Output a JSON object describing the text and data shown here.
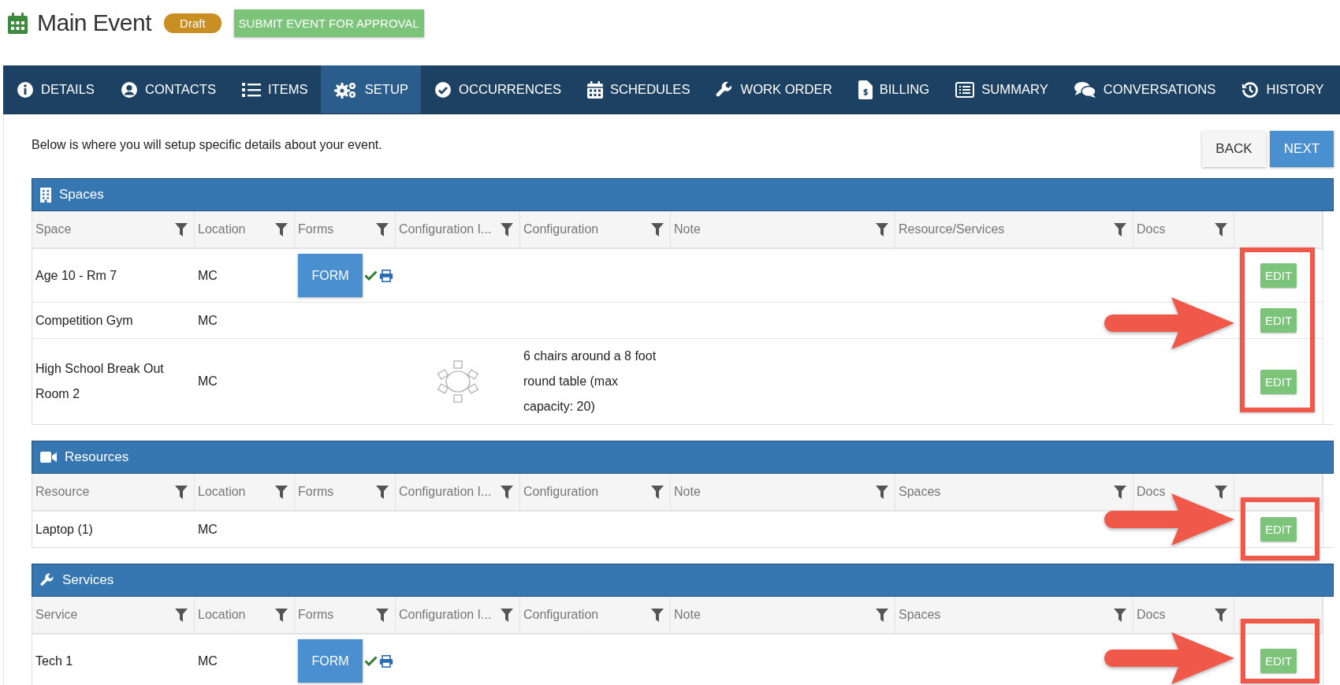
{
  "header": {
    "title": "Main Event",
    "status_badge": "Draft",
    "submit_button": "SUBMIT EVENT FOR APPROVAL"
  },
  "tabs": [
    {
      "label": "DETAILS",
      "selected": false
    },
    {
      "label": "CONTACTS",
      "selected": false
    },
    {
      "label": "ITEMS",
      "selected": false
    },
    {
      "label": "SETUP",
      "selected": true
    },
    {
      "label": "OCCURRENCES",
      "selected": false
    },
    {
      "label": "SCHEDULES",
      "selected": false
    },
    {
      "label": "WORK ORDER",
      "selected": false
    },
    {
      "label": "BILLING",
      "selected": false
    },
    {
      "label": "SUMMARY",
      "selected": false
    },
    {
      "label": "CONVERSATIONS",
      "selected": false
    },
    {
      "label": "HISTORY",
      "selected": false
    }
  ],
  "intro": "Below is where you will setup specific details about your event.",
  "nav_buttons": {
    "back": "BACK",
    "next": "NEXT"
  },
  "sections": [
    {
      "title": "Spaces",
      "columns": [
        "Space",
        "Location",
        "Forms",
        "Configuration I...",
        "Configuration",
        "Note",
        "Resource/Services",
        "Docs"
      ],
      "rows": [
        {
          "name": "Age 10 - Rm 7",
          "location": "MC",
          "form": "FORM",
          "form_completed": true,
          "layout_image": false,
          "action": "EDIT"
        },
        {
          "name": "Competition Gym",
          "location": "MC",
          "layout_image": false,
          "action": "EDIT"
        },
        {
          "name": "High School Break Out Room 2",
          "location": "MC",
          "layout_image": true,
          "configuration": "6 chairs around a 8 foot round table (max capacity: 20)",
          "action": "EDIT"
        }
      ]
    },
    {
      "title": "Resources",
      "columns": [
        "Resource",
        "Location",
        "Forms",
        "Configuration I...",
        "Configuration",
        "Note",
        "Spaces",
        "Docs"
      ],
      "rows": [
        {
          "name": "Laptop (1)",
          "location": "MC",
          "layout_image": false,
          "action": "EDIT"
        }
      ]
    },
    {
      "title": "Services",
      "columns": [
        "Service",
        "Location",
        "Forms",
        "Configuration I...",
        "Configuration",
        "Note",
        "Spaces",
        "Docs"
      ],
      "rows": [
        {
          "name": "Tech 1",
          "location": "MC",
          "form": "FORM",
          "form_completed": true,
          "layout_image": false,
          "action": "EDIT"
        }
      ]
    }
  ]
}
